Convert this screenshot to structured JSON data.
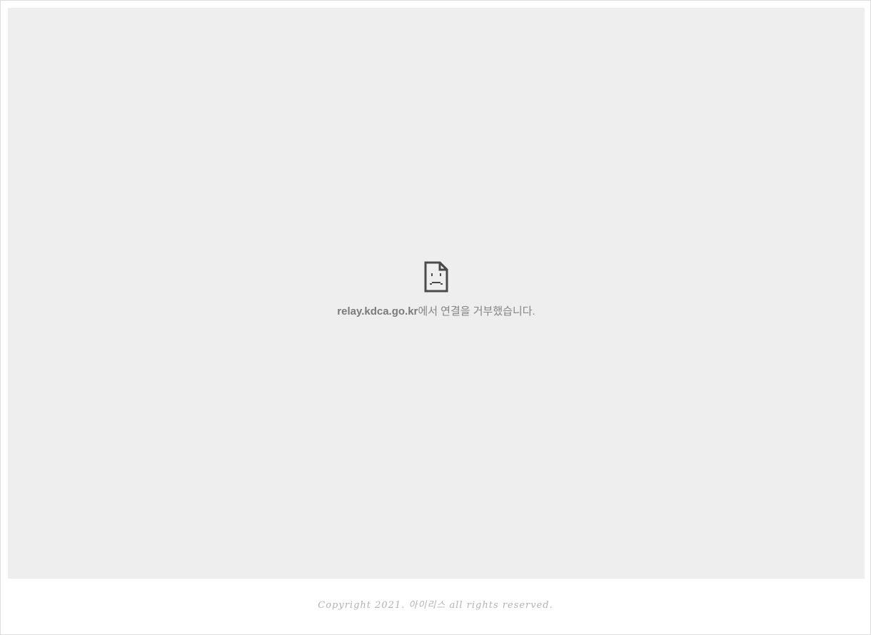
{
  "embedded_frame": {
    "error": {
      "icon": "sad-page-icon",
      "host": "relay.kdca.go.kr",
      "message": "에서 연결을 거부했습니다."
    }
  },
  "footer": {
    "copyright": "Copyright 2021. 아이리스 all rights reserved."
  },
  "colors": {
    "frame_background": "#eeeeee",
    "error_text": "#858585",
    "icon": "#4a4a4a",
    "footer_text": "#b3b3b3"
  }
}
